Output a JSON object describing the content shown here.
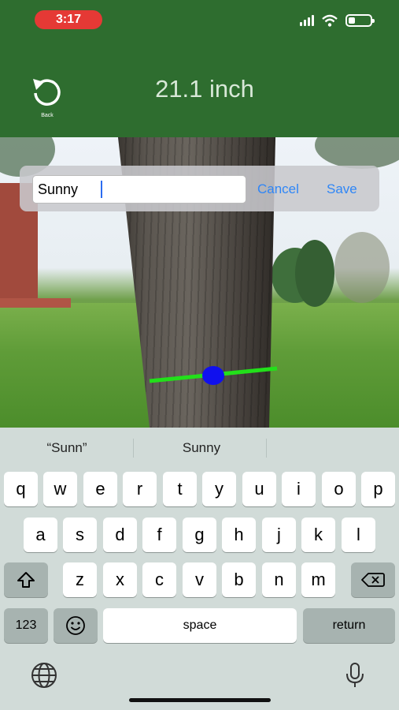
{
  "status_bar": {
    "time": "3:17",
    "battery_icon": "battery-icon",
    "wifi_icon": "wifi-icon",
    "signal_icon": "cellular-signal-icon"
  },
  "header": {
    "back_label": "Back",
    "back_icon": "undo-arrow-icon",
    "measurement": "21.1 inch",
    "bg_color": "#2e6d2f"
  },
  "dialog": {
    "input_value": "Sunny",
    "cancel_label": "Cancel",
    "save_label": "Save",
    "accent_color": "#2f86f6"
  },
  "measure_overlay": {
    "line_color": "#22e01a",
    "handle_color": "#1010ee"
  },
  "keyboard": {
    "suggestions": [
      "“Sunn”",
      "Sunny",
      ""
    ],
    "row1": [
      "q",
      "w",
      "e",
      "r",
      "t",
      "y",
      "u",
      "i",
      "o",
      "p"
    ],
    "row2": [
      "a",
      "s",
      "d",
      "f",
      "g",
      "h",
      "j",
      "k",
      "l"
    ],
    "row3": [
      "z",
      "x",
      "c",
      "v",
      "b",
      "n",
      "m"
    ],
    "numbers_label": "123",
    "space_label": "space",
    "return_label": "return"
  }
}
